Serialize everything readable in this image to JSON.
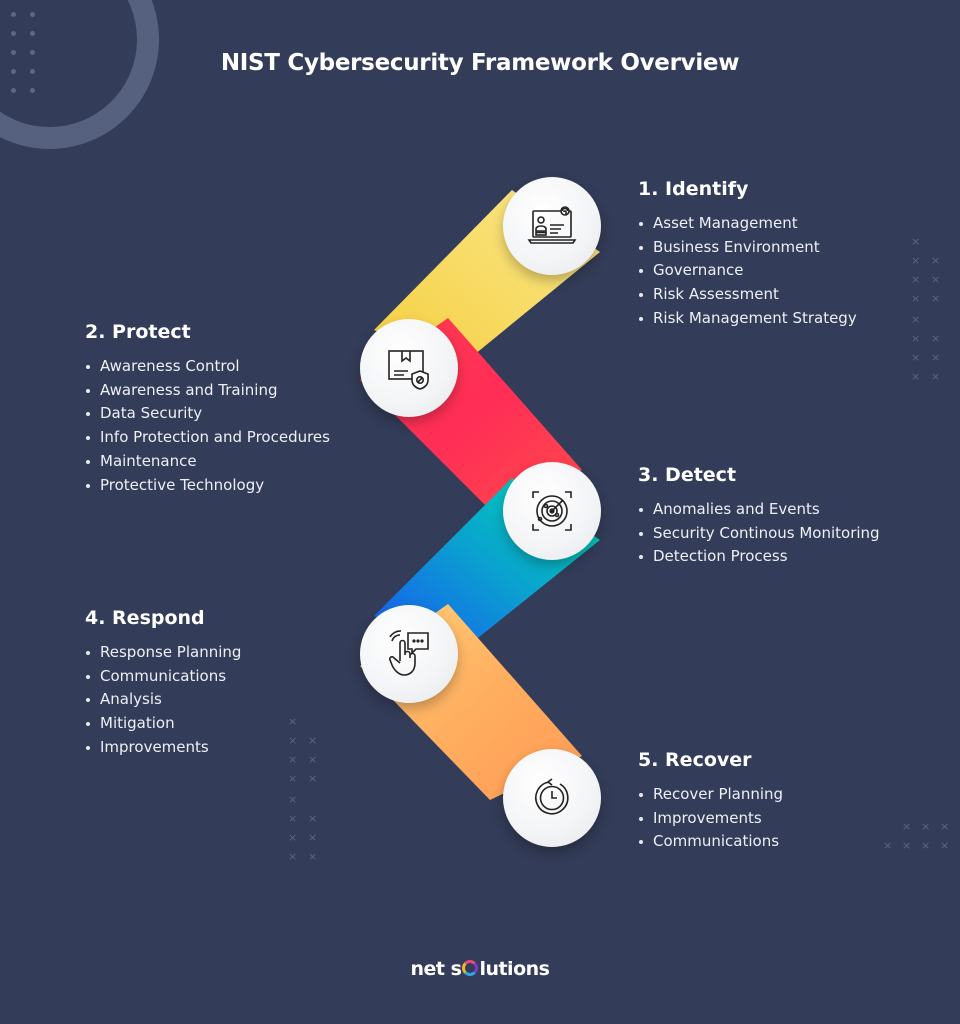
{
  "title": "NIST Cybersecurity Framework Overview",
  "colors": {
    "background": "#333c58",
    "identify_band": [
      "#f7d348",
      "#fbe88d"
    ],
    "protect_band": [
      "#ff2a5c",
      "#ff5a3f"
    ],
    "detect_band": [
      "#1d5df0",
      "#00d4b4"
    ],
    "respond_band": [
      "#ff9b52",
      "#ffd57a"
    ]
  },
  "sections": [
    {
      "id": "identify",
      "heading": "1. Identify",
      "icon": "laptop-user-fingerprint-icon",
      "items": [
        "Asset Management",
        "Business Environment",
        "Governance",
        "Risk Assessment",
        "Risk Management Strategy"
      ]
    },
    {
      "id": "protect",
      "heading": "2. Protect",
      "icon": "box-shield-icon",
      "items": [
        "Awareness Control",
        "Awareness and Training",
        "Data Security",
        "Info Protection and Procedures",
        "Maintenance",
        "Protective Technology"
      ]
    },
    {
      "id": "detect",
      "heading": "3. Detect",
      "icon": "radar-scan-icon",
      "items": [
        "Anomalies and Events",
        "Security Continous Monitoring",
        "Detection Process"
      ]
    },
    {
      "id": "respond",
      "heading": "4. Respond",
      "icon": "hand-tap-chat-icon",
      "items": [
        "Response Planning",
        "Communications",
        "Analysis",
        "Mitigation",
        "Improvements"
      ]
    },
    {
      "id": "recover",
      "heading": "5. Recover",
      "icon": "clock-restore-icon",
      "items": [
        "Recover Planning",
        "Improvements",
        "Communications"
      ]
    }
  ],
  "logo": {
    "part1": "net s",
    "part2": "lutions"
  }
}
